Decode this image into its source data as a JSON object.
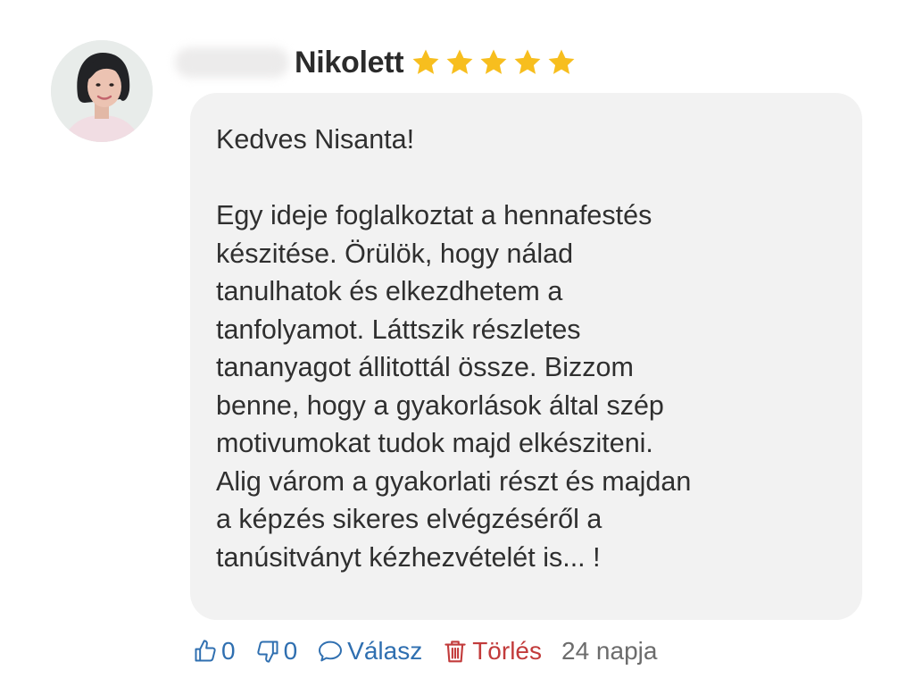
{
  "review": {
    "author_name": "Nikolett",
    "rating": 5,
    "star_color": "#f7be1e",
    "greeting": "Kedves Nisanta!",
    "body_lines": [
      "Egy ideje foglalkoztat a hennafestés",
      "készitése. Örülök, hogy nálad",
      "tanulhatok és elkezdhetem a",
      "tanfolyamot. Láttszik részletes",
      "tananyagot állitottál össze. Bizzom",
      "benne, hogy a gyakorlások által szép",
      "motivumokat tudok majd elkésziteni.",
      "Alig várom a gyakorlati részt és majdan",
      "a képzés sikeres elvégzéséről a",
      "tanúsitványt kézhezvételét is... !"
    ]
  },
  "actions": {
    "like_icon": "thumbs-up-icon",
    "like_count": "0",
    "dislike_icon": "thumbs-down-icon",
    "dislike_count": "0",
    "reply_icon": "speech-bubble-icon",
    "reply_label": "Válasz",
    "delete_icon": "trash-icon",
    "delete_label": "Törlés",
    "age": "24 napja"
  },
  "colors": {
    "action_blue": "#2f6fb0",
    "delete_red": "#c23b3b",
    "bubble_bg": "#f2f2f2"
  }
}
